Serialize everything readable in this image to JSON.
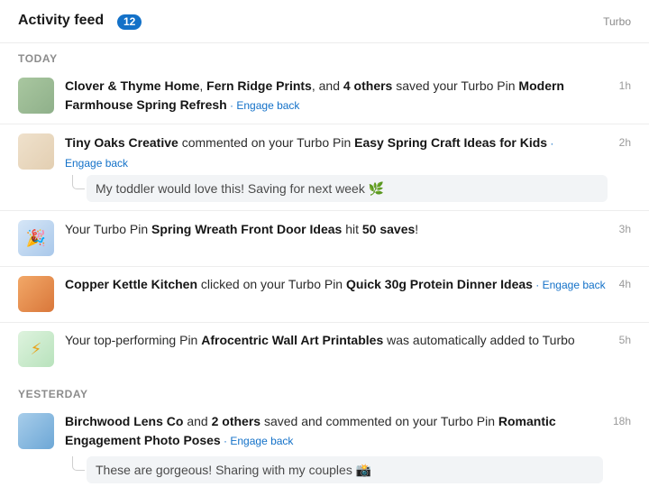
{
  "header": {
    "title": "Activity feed",
    "count": "12",
    "app_label": "Turbo"
  },
  "sections": {
    "today": "TODAY",
    "yesterday": "YESTERDAY"
  },
  "engage_label": "Engage back",
  "items": [
    {
      "icon": "green-thumbnail",
      "time": "1h",
      "actor1": "Clover & Thyme Home",
      "sep1": ", ",
      "actor2": "Fern Ridge Prints",
      "sep2": ", and ",
      "others": "4 others",
      "action": " saved your Turbo Pin ",
      "pin": "Modern Farmhouse Spring Refresh"
    },
    {
      "icon": "beige-thumbnail",
      "time": "2h",
      "actor": "Tiny Oaks Creative",
      "action": " commented on your Turbo Pin ",
      "pin": "Easy Spring Craft Ideas for Kids",
      "reply": "My toddler would love this! Saving for next week 🌿"
    },
    {
      "icon": "party-popper-icon",
      "glyph": "🎉",
      "time": "3h",
      "prefix": "Your Turbo Pin ",
      "pin": "Spring Wreath Front Door Ideas",
      "mid": " hit ",
      "milestone": "50 saves",
      "suffix": "!"
    },
    {
      "icon": "orange-thumbnail",
      "time": "4h",
      "actor": "Copper Kettle Kitchen",
      "action": " clicked on your Turbo Pin ",
      "pin": "Quick 30g Protein Dinner Ideas"
    },
    {
      "icon": "lightning-icon",
      "glyph": "⚡",
      "time": "5h",
      "prefix": "Your top-performing Pin ",
      "pin": "Afrocentric Wall Art Printables",
      "suffix": " was automatically added to Turbo"
    },
    {
      "icon": "blue-thumbnail",
      "time": "18h",
      "actor": "Birchwood Lens Co",
      "mid": " and ",
      "others": "2 others",
      "action": " saved and commented on your Turbo Pin ",
      "pin": "Romantic Engagement Photo Poses",
      "reply": "These are gorgeous! Sharing with my couples 📸"
    }
  ],
  "separators": {
    "dot": " · ",
    "dot_tail": " ·"
  }
}
